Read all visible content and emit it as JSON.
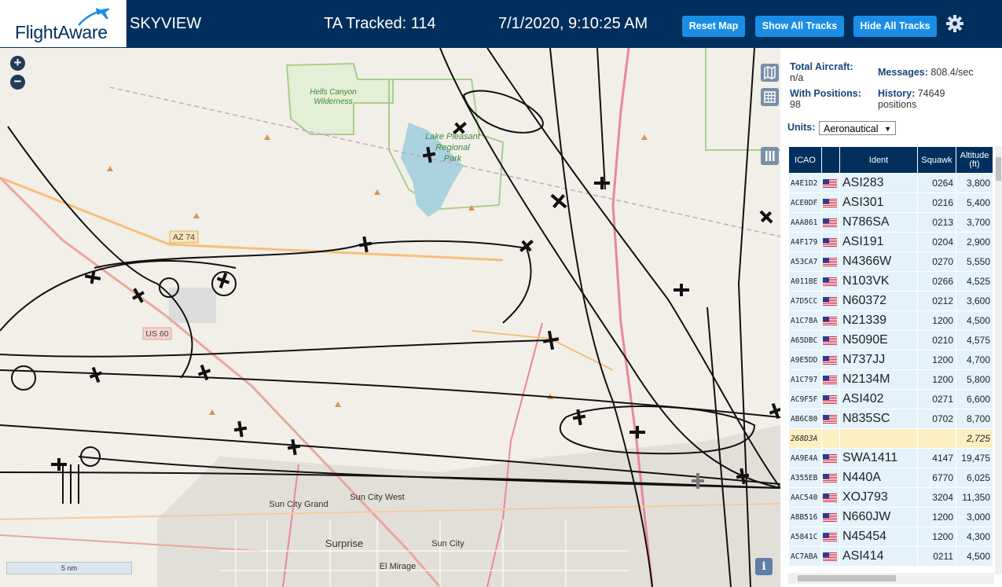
{
  "header": {
    "logo_text": "FlightAware",
    "app_title": "SKYVIEW",
    "tracked": "TA Tracked: 114",
    "datetime": "7/1/2020, 9:10:25 AM",
    "buttons": {
      "reset": "Reset Map",
      "show_all": "Show All Tracks",
      "hide_all": "Hide All Tracks"
    },
    "settings_icon": "gear-icon"
  },
  "map": {
    "zoom_in": "+",
    "zoom_out": "−",
    "scale": "5 nm",
    "info": "i",
    "labels": {
      "hells_canyon": [
        "Hells Canyon",
        "Wilderness"
      ],
      "lake": [
        "Lake Pleasant",
        "Regional",
        "Park"
      ],
      "az74": "AZ 74",
      "us60": "US 60",
      "sun_city_grand": "Sun City Grand",
      "sun_city_west": "Sun City West",
      "surprise": "Surprise",
      "sun_city": "Sun City",
      "el_mirage": "El Mirage"
    }
  },
  "stats": {
    "total_label": "Total Aircraft:",
    "total_value": "n/a",
    "positions_label": "With Positions:",
    "positions_value": "98",
    "messages_label": "Messages:",
    "messages_value": "808.4/sec",
    "history_label": "History:",
    "history_value": "74649",
    "history_unit": "positions"
  },
  "units": {
    "label": "Units:",
    "selected": "Aeronautical"
  },
  "table": {
    "headers": {
      "icao": "ICAO",
      "flag": "",
      "ident": "Ident",
      "squawk": "Squawk",
      "altitude": "Altitude",
      "altitude_unit": "(ft)"
    },
    "rows": [
      {
        "icao": "A4E1D2",
        "ident": "ASI283",
        "squawk": "0264",
        "altitude": "3,800"
      },
      {
        "icao": "ACE0DF",
        "ident": "ASI301",
        "squawk": "0216",
        "altitude": "5,400"
      },
      {
        "icao": "AAA861",
        "ident": "N786SA",
        "squawk": "0213",
        "altitude": "3,700"
      },
      {
        "icao": "A4F179",
        "ident": "ASI191",
        "squawk": "0204",
        "altitude": "2,900"
      },
      {
        "icao": "A53CA7",
        "ident": "N4366W",
        "squawk": "0270",
        "altitude": "5,550"
      },
      {
        "icao": "A011BE",
        "ident": "N103VK",
        "squawk": "0266",
        "altitude": "4,525"
      },
      {
        "icao": "A7D5CC",
        "ident": "N60372",
        "squawk": "0212",
        "altitude": "3,600"
      },
      {
        "icao": "A1C78A",
        "ident": "N21339",
        "squawk": "1200",
        "altitude": "4,500"
      },
      {
        "icao": "A65DBC",
        "ident": "N5090E",
        "squawk": "0210",
        "altitude": "4,575"
      },
      {
        "icao": "A9E5DD",
        "ident": "N737JJ",
        "squawk": "1200",
        "altitude": "4,700"
      },
      {
        "icao": "A1C797",
        "ident": "N2134M",
        "squawk": "1200",
        "altitude": "5,800"
      },
      {
        "icao": "AC9F5F",
        "ident": "ASI402",
        "squawk": "0271",
        "altitude": "6,600"
      },
      {
        "icao": "AB6C80",
        "ident": "N835SC",
        "squawk": "0702",
        "altitude": "8,700"
      },
      {
        "icao": "268D3A",
        "ident": "",
        "squawk": "",
        "altitude": "2,725",
        "highlight": true,
        "no_flag": true
      },
      {
        "icao": "AA9E4A",
        "ident": "SWA1411",
        "squawk": "4147",
        "altitude": "19,475"
      },
      {
        "icao": "A355EB",
        "ident": "N440A",
        "squawk": "6770",
        "altitude": "6,025"
      },
      {
        "icao": "AAC540",
        "ident": "XOJ793",
        "squawk": "3204",
        "altitude": "11,350"
      },
      {
        "icao": "A8B516",
        "ident": "N660JW",
        "squawk": "1200",
        "altitude": "3,000"
      },
      {
        "icao": "A5841C",
        "ident": "N45454",
        "squawk": "1200",
        "altitude": "4,300"
      },
      {
        "icao": "AC7ABA",
        "ident": "ASI414",
        "squawk": "0211",
        "altitude": "4,500"
      }
    ]
  },
  "colors": {
    "header_bg": "#002f5d",
    "button_blue": "#1a8ee6",
    "row_bg": "#e4f2fb",
    "row_highlight": "#fcf0c3"
  }
}
